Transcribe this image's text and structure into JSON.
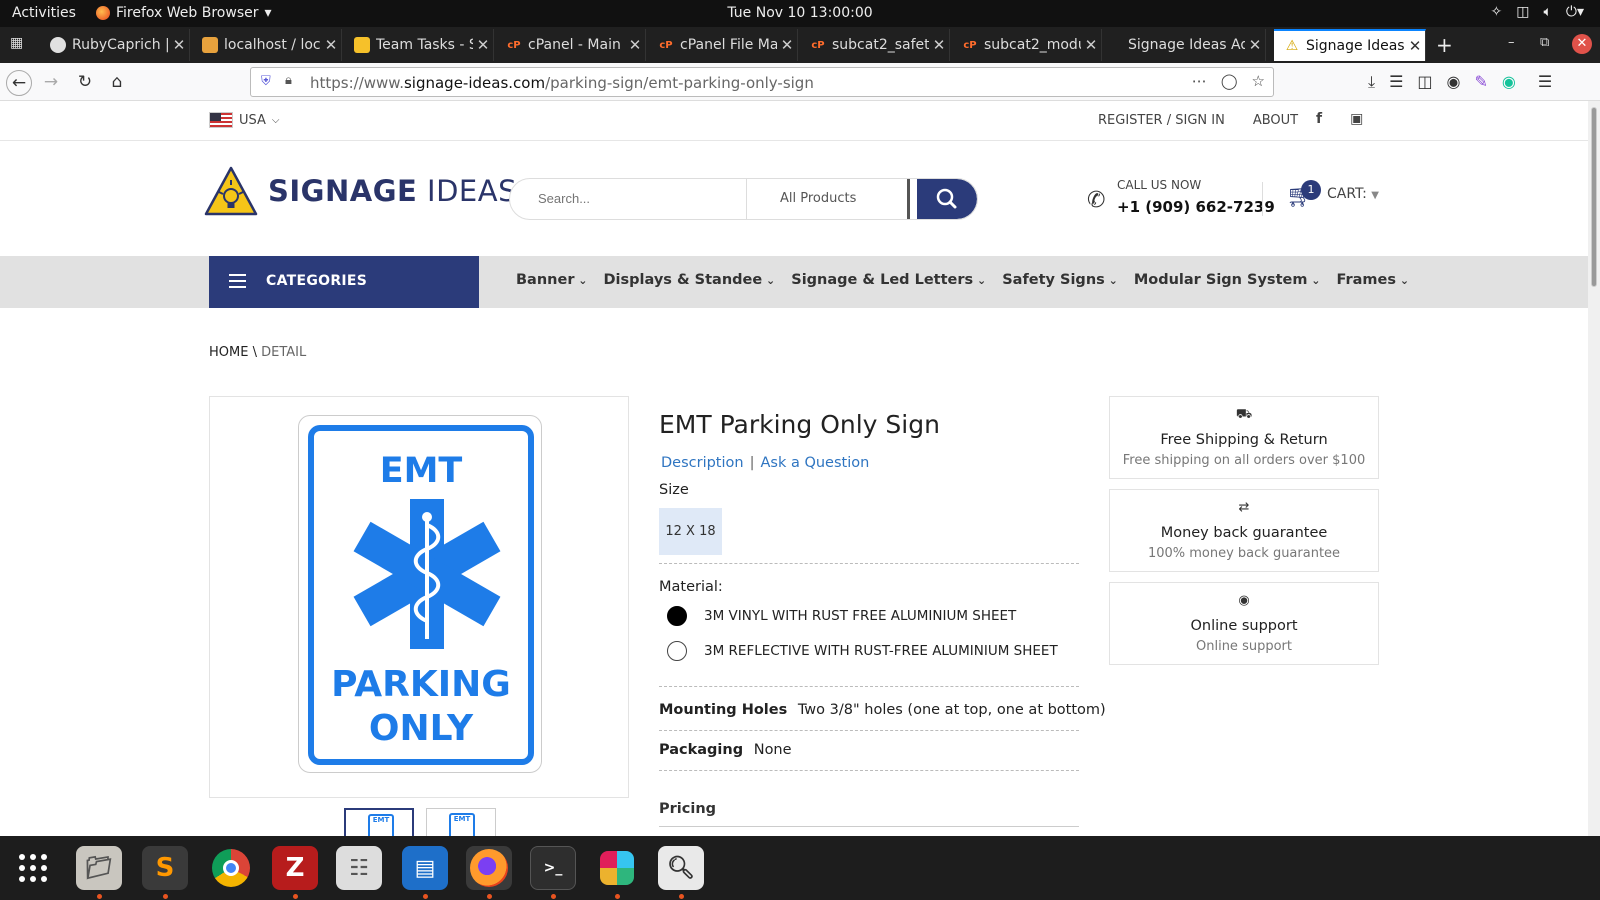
{
  "system": {
    "activities": "Activities",
    "app_name": "Firefox Web Browser",
    "clock": "Tue Nov 10  13:00:00"
  },
  "tabs": [
    {
      "title": "RubyCaprich |",
      "color": "#e0e0e0"
    },
    {
      "title": "localhost / loc",
      "color": "#e8a23d"
    },
    {
      "title": "Team Tasks - S",
      "color": "#f6c12a"
    },
    {
      "title": "cPanel - Main",
      "color": "#ff6c2c"
    },
    {
      "title": "cPanel File Ma",
      "color": "#ff6c2c"
    },
    {
      "title": "subcat2_safet",
      "color": "#ff6c2c"
    },
    {
      "title": "subcat2_modu",
      "color": "#ff6c2c"
    },
    {
      "title": "Signage Ideas Ad",
      "color": ""
    },
    {
      "title": "Signage Ideas",
      "color": "#f6c12a"
    }
  ],
  "browser": {
    "url_prefix": "https://www.",
    "url_domain": "signage-ideas.com",
    "url_path": "/parking-sign/emt-parking-only-sign"
  },
  "utility": {
    "country": "USA",
    "register": "REGISTER / SIGN IN",
    "about": "ABOUT"
  },
  "header": {
    "logo_bold": "SIGNAGE",
    "logo_light": " IDEAS",
    "search_placeholder": "Search...",
    "search_category": "All Products",
    "call_label": "CALL US NOW",
    "phone": "+1 (909) 662-7239",
    "cart_count": "1",
    "cart_label": "CART:"
  },
  "nav": {
    "categories": "CATEGORIES",
    "items": [
      "Banner",
      "Displays & Standee",
      "Signage & Led Letters",
      "Safety Signs",
      "Modular Sign System",
      "Frames"
    ]
  },
  "breadcrumb": {
    "home": "HOME",
    "sep": " \\ ",
    "current": "DETAIL"
  },
  "sign": {
    "line1": "EMT",
    "line2": "PARKING",
    "line3": "ONLY"
  },
  "product": {
    "title": "EMT Parking Only Sign",
    "tab_description": "Description",
    "tab_separator": "|",
    "tab_question": "Ask a Question",
    "size_label": "Size",
    "size_option": "12 X 18",
    "material_label": "Material:",
    "materials": [
      {
        "label": "3M VINYL WITH RUST FREE ALUMINIUM SHEET",
        "selected": true
      },
      {
        "label": "3M REFLECTIVE WITH RUST-FREE ALUMINIUM SHEET",
        "selected": false
      }
    ],
    "mounting_label": "Mounting Holes",
    "mounting_value": "Two 3/8\" holes (one at top, one at bottom)",
    "packaging_label": "Packaging",
    "packaging_value": "None",
    "pricing_label": "Pricing"
  },
  "benefits": [
    {
      "icon": "truck-icon",
      "title": "Free Shipping & Return",
      "sub": "Free shipping on all orders over $100"
    },
    {
      "icon": "exchange-icon",
      "title": "Money back guarantee",
      "sub": "100% money back guarantee"
    },
    {
      "icon": "lifebuoy-icon",
      "title": "Online support",
      "sub": "Online support"
    }
  ],
  "colors": {
    "brand": "#2b3b7a",
    "sign_blue": "#1e7ce8",
    "link": "#2f75c1"
  }
}
